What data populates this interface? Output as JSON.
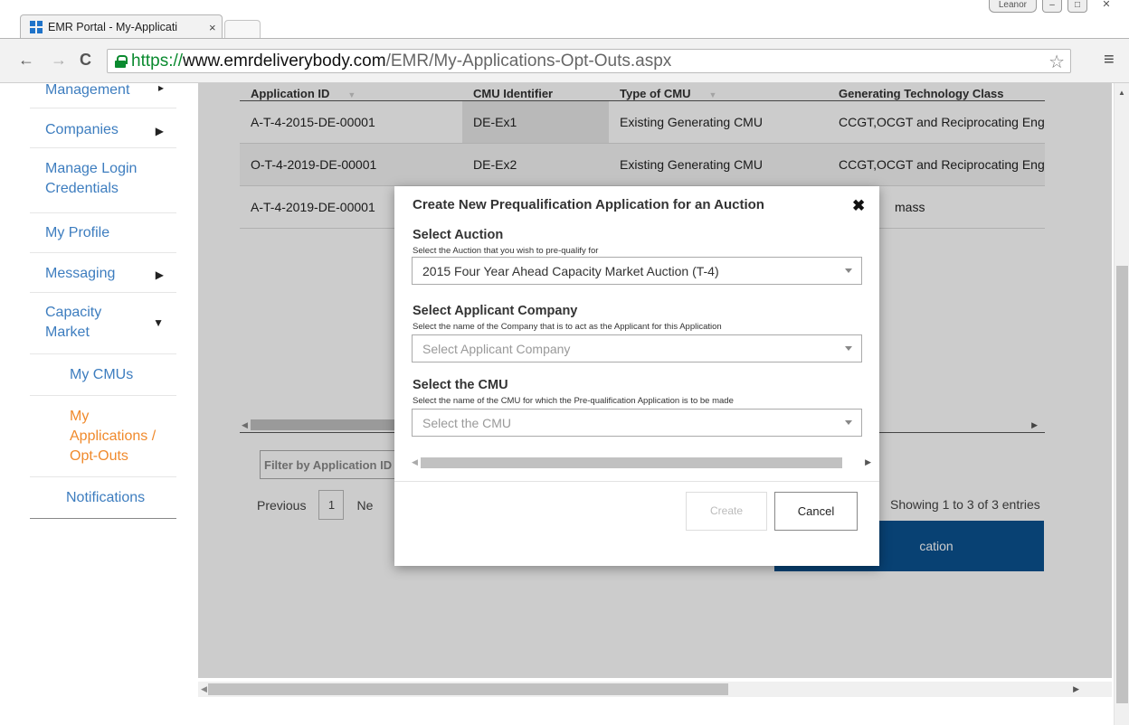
{
  "browser": {
    "tab_title": "EMR Portal - My-Applicati",
    "tab_close": "×",
    "window_user": "Leanor",
    "url_scheme": "https://",
    "url_host": "www.emrdeliverybody.com",
    "url_path": "/EMR/My-Applications-Opt-Outs.aspx",
    "icons": [
      "back-icon",
      "forward-icon",
      "reload-icon",
      "lock-icon",
      "star-icon",
      "menu-icon"
    ]
  },
  "sidebar": {
    "items": [
      {
        "label": "Management",
        "arrow": "▸"
      },
      {
        "label": "Companies",
        "arrow": "▶"
      },
      {
        "label": "Manage Login Credentials",
        "arrow": ""
      },
      {
        "label": "My Profile",
        "arrow": ""
      },
      {
        "label": "Messaging",
        "arrow": "▶"
      },
      {
        "label": "Capacity Market",
        "arrow": "▼"
      },
      {
        "label": "My CMUs",
        "arrow": ""
      },
      {
        "label": "My Applications / Opt-Outs",
        "arrow": ""
      },
      {
        "label": "Notifications",
        "arrow": ""
      }
    ],
    "active_color": "#f08a2c",
    "link_color": "#3d7dbf"
  },
  "table": {
    "headers": [
      "Application ID",
      "CMU Identifier",
      "Type of CMU",
      "Generating Technology Class"
    ],
    "rows": [
      [
        "A-T-4-2015-DE-00001",
        "DE-Ex1",
        "Existing Generating CMU",
        "CCGT,OCGT and Reciprocating Eng"
      ],
      [
        "O-T-4-2019-DE-00001",
        "DE-Ex2",
        "Existing Generating CMU",
        "CCGT,OCGT and Reciprocating Eng"
      ],
      [
        "A-T-4-2019-DE-00001",
        "",
        "",
        "mass"
      ]
    ]
  },
  "filter": {
    "placeholder": "Filter by Application ID"
  },
  "pager": {
    "previous": "Previous",
    "page": "1",
    "next": "Ne",
    "showing": "Showing 1 to 3 of 3 entries"
  },
  "create_application_label": "cation",
  "modal": {
    "title": "Create New Prequalification Application for an Auction",
    "close": "✖",
    "auction": {
      "label": "Select Auction",
      "help": "Select the Auction that you wish to pre-qualify for",
      "value": "2015 Four Year Ahead Capacity Market Auction (T-4)"
    },
    "company": {
      "label": "Select Applicant Company",
      "help": "Select the name of the Company that is to act as the Applicant for this Application",
      "placeholder": "Select Applicant Company"
    },
    "cmu": {
      "label": "Select the CMU",
      "help": "Select the name of the CMU for which the Pre-qualification Application is to be made",
      "placeholder": "Select the CMU"
    },
    "create_label": "Create",
    "cancel_label": "Cancel"
  }
}
